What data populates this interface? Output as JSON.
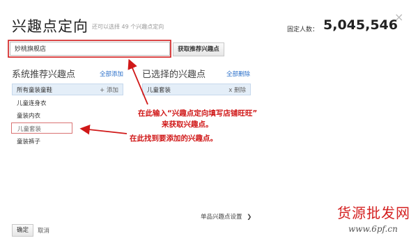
{
  "header": {
    "title": "兴趣点定向",
    "subtitle": "还可以选择 49 个兴趣点定向",
    "fixed_people_label": "固定人数：",
    "fixed_people_value": "5,045,546",
    "close_glyph": "×"
  },
  "search": {
    "value": "妙桃旗舰店",
    "fetch_button_label": "获取推荐兴趣点"
  },
  "recommended": {
    "title": "系统推荐兴趣点",
    "add_all_label": "全部添加",
    "header_item": {
      "label": "所有童装童鞋",
      "action": "+ 添加"
    },
    "items": [
      "儿童连身衣",
      "童装内衣",
      "儿童套装",
      "童装裤子"
    ]
  },
  "selected": {
    "title": "已选择的兴趣点",
    "delete_all_label": "全部删除",
    "items": [
      {
        "label": "儿童套装",
        "action": "x 删除"
      }
    ]
  },
  "annotations": {
    "line1": "在此输入“兴趣点定向填写店铺旺旺”",
    "line2": "来获取兴趣点。",
    "line3": "在此找到要添加的兴趣点。",
    "color": "#d01818"
  },
  "footer": {
    "single_setting_label": "单品兴趣点设置",
    "single_setting_chevron": "❯",
    "ok_label": "确定",
    "cancel_label": "取消"
  },
  "watermark": {
    "brand": "货源批发网",
    "url": "www.6pf.cn"
  }
}
